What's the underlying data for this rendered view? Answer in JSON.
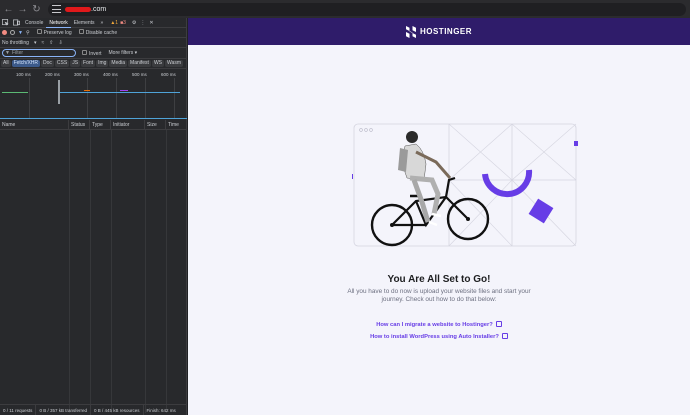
{
  "browser": {
    "url_suffix": ".com"
  },
  "devtools": {
    "tabs": [
      "Console",
      "Network",
      "Elements"
    ],
    "active_tab": "Network",
    "warn_count": "1",
    "error_count": "3",
    "preserve_log": "Preserve log",
    "disable_cache": "Disable cache",
    "throttling": "No throttling",
    "filter_placeholder": "Filter",
    "invert": "Invert",
    "more_filters": "More filters",
    "type_filters": [
      "All",
      "Fetch/XHR",
      "Doc",
      "CSS",
      "JS",
      "Font",
      "Img",
      "Media",
      "Manifest",
      "WS",
      "Wasm"
    ],
    "active_filter": "Fetch/XHR",
    "timeline_ticks": [
      "100 ms",
      "200 ms",
      "300 ms",
      "400 ms",
      "500 ms",
      "600 ms"
    ],
    "columns": [
      "Name",
      "Status",
      "Type",
      "Initiator",
      "Size",
      "Time"
    ],
    "status": {
      "requests": "0 / 11 requests",
      "transferred": "0 B / 357 kB transferred",
      "resources": "0 B / 445 kB resources",
      "finish": "Finish: 642 ms"
    }
  },
  "page": {
    "brand": "HOSTINGER",
    "brand_color": "#2f1c6a",
    "accent_color": "#673de6",
    "headline": "You Are All Set to Go!",
    "subtext": "All you have to do now is upload your website files and start your journey. Check out how to do that below:",
    "links": [
      "How can I migrate a website to Hostinger?",
      "How to install WordPress using Auto Installer?"
    ]
  }
}
